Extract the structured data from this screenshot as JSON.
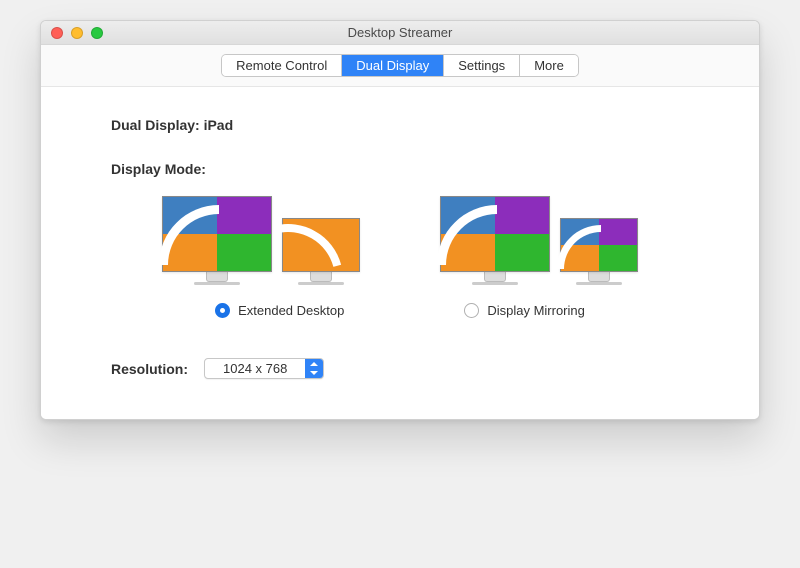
{
  "window": {
    "title": "Desktop Streamer"
  },
  "tabs": [
    {
      "label": "Remote Control",
      "active": false
    },
    {
      "label": "Dual Display",
      "active": true
    },
    {
      "label": "Settings",
      "active": false
    },
    {
      "label": "More",
      "active": false
    }
  ],
  "heading": "Dual Display: iPad",
  "display_mode_label": "Display Mode:",
  "modes": {
    "extended": {
      "label": "Extended Desktop",
      "selected": true
    },
    "mirroring": {
      "label": "Display Mirroring",
      "selected": false
    }
  },
  "resolution": {
    "label": "Resolution:",
    "value": "1024 x 768"
  },
  "colors": {
    "accent": "#2f83f7",
    "blue": "#3f7fc0",
    "purple": "#8c2dbb",
    "orange": "#f29122",
    "green": "#2fb62f"
  }
}
